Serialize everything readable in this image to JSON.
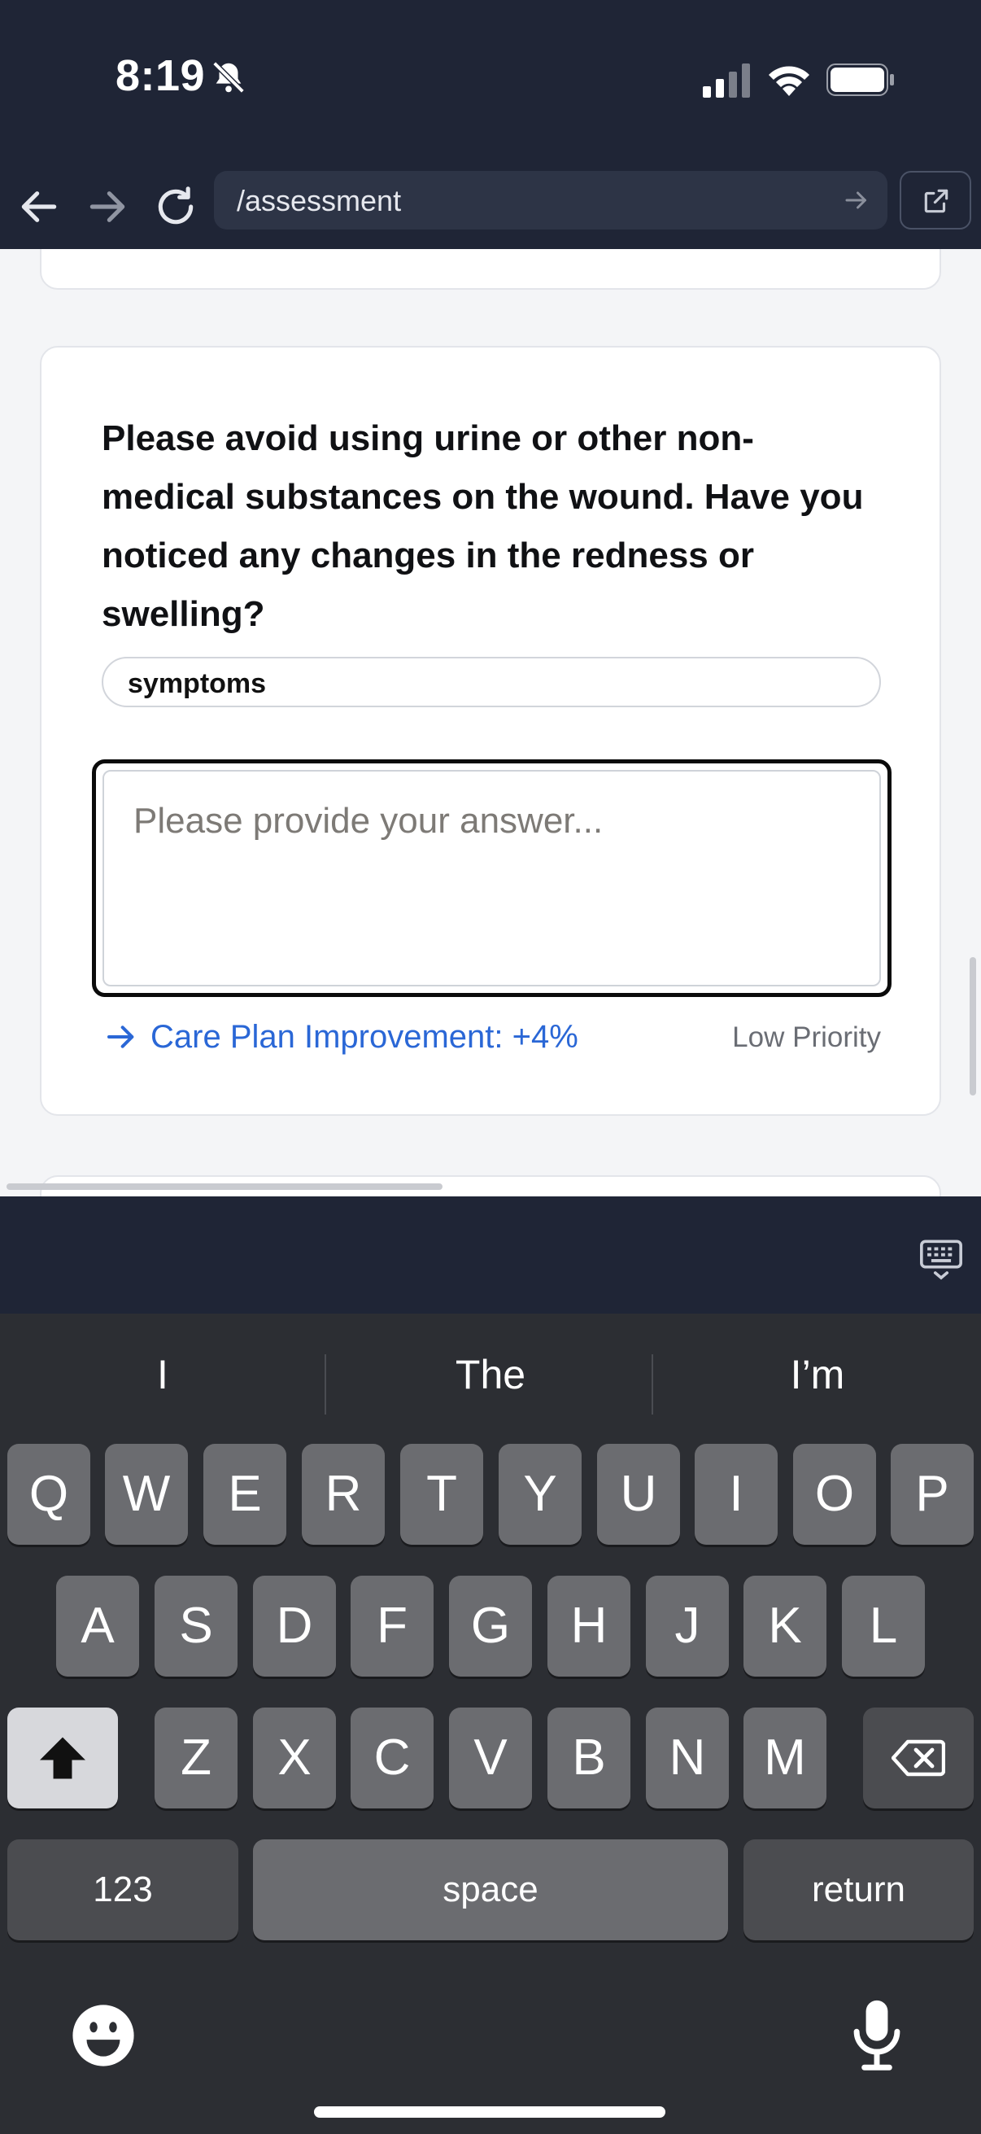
{
  "status_bar": {
    "time": "8:19"
  },
  "browser": {
    "url": "/assessment"
  },
  "question_card": {
    "question": "Please avoid using urine or other non-medical substances on the wound. Have you noticed any changes in the redness or swelling?",
    "category_tag": "symptoms",
    "answer_placeholder": "Please provide your answer...",
    "answer_value": "",
    "improvement_label": "Care Plan Improvement: +4%",
    "priority_label": "Low Priority",
    "accent_color": "#2a67d6"
  },
  "keyboard": {
    "suggestions": [
      "I",
      "The",
      "I’m"
    ],
    "row1": [
      "Q",
      "W",
      "E",
      "R",
      "T",
      "Y",
      "U",
      "I",
      "O",
      "P"
    ],
    "row2": [
      "A",
      "S",
      "D",
      "F",
      "G",
      "H",
      "J",
      "K",
      "L"
    ],
    "row3": [
      "Z",
      "X",
      "C",
      "V",
      "B",
      "N",
      "M"
    ],
    "numbers_label": "123",
    "space_label": "space",
    "return_label": "return"
  }
}
